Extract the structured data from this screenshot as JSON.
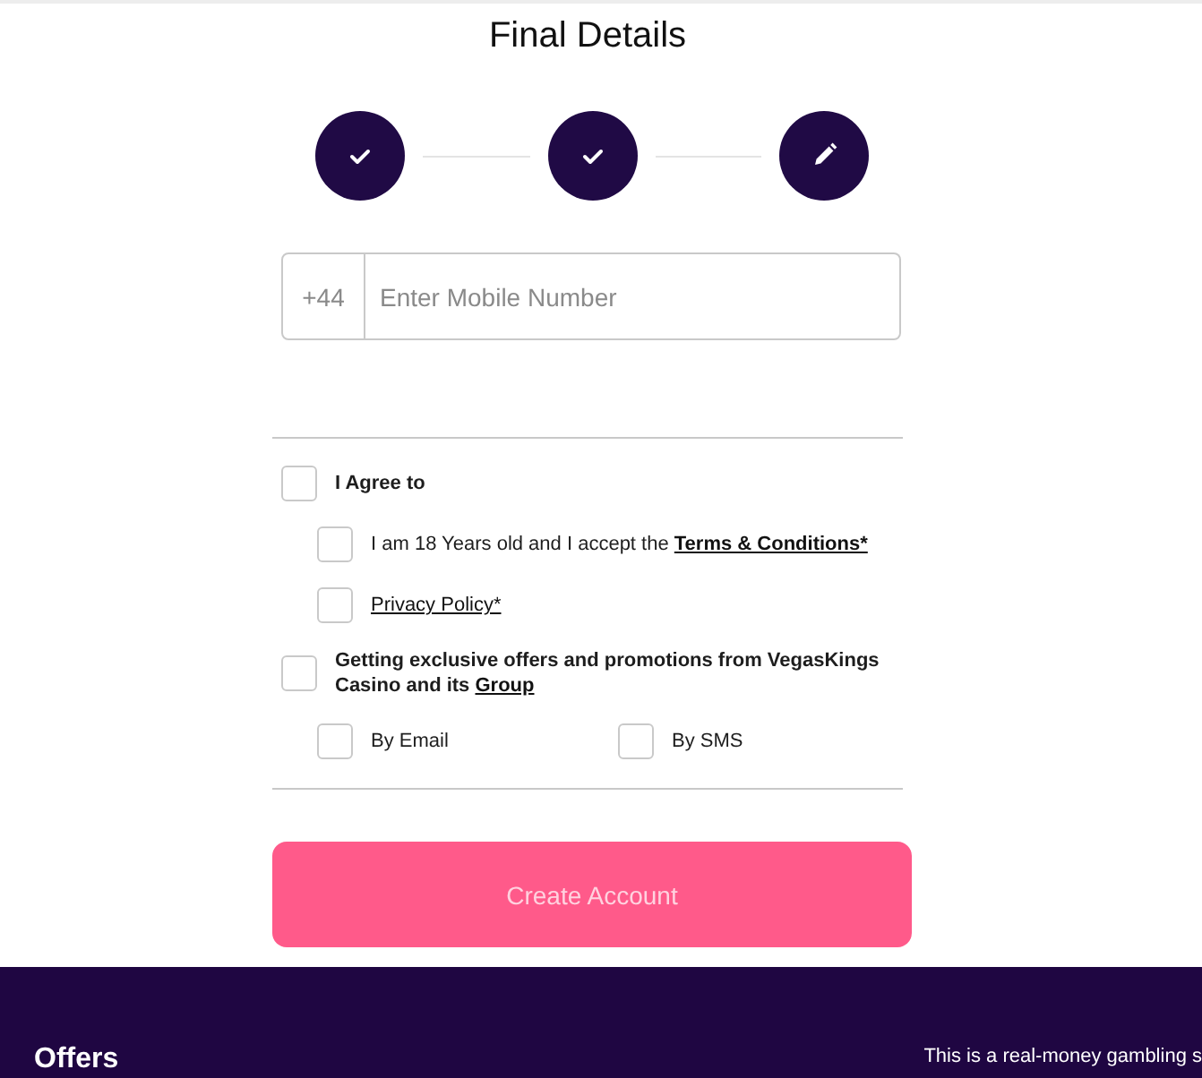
{
  "title": "Final Details",
  "steps": [
    {
      "completed": true
    },
    {
      "completed": true
    },
    {
      "completed": false
    }
  ],
  "phone": {
    "prefix": "+44",
    "placeholder": "Enter Mobile Number"
  },
  "agree_section": {
    "label": "I Agree to",
    "checked": false,
    "items": [
      {
        "text": "I am 18 Years old and I accept the ",
        "link": "Terms & Conditions*",
        "checked": false
      },
      {
        "link": "Privacy Policy*",
        "checked": false
      }
    ]
  },
  "offers_section": {
    "text": "Getting exclusive offers and promotions from VegasKings Casino and its ",
    "link": "Group",
    "checked": false,
    "channels": [
      {
        "label": "By Email",
        "checked": false
      },
      {
        "label": "By SMS",
        "checked": false
      }
    ]
  },
  "create_button": {
    "label": "Create Account",
    "disabled": true
  },
  "footer": {
    "heading": "Offers",
    "notice": "This is a real-money gambling s"
  }
}
